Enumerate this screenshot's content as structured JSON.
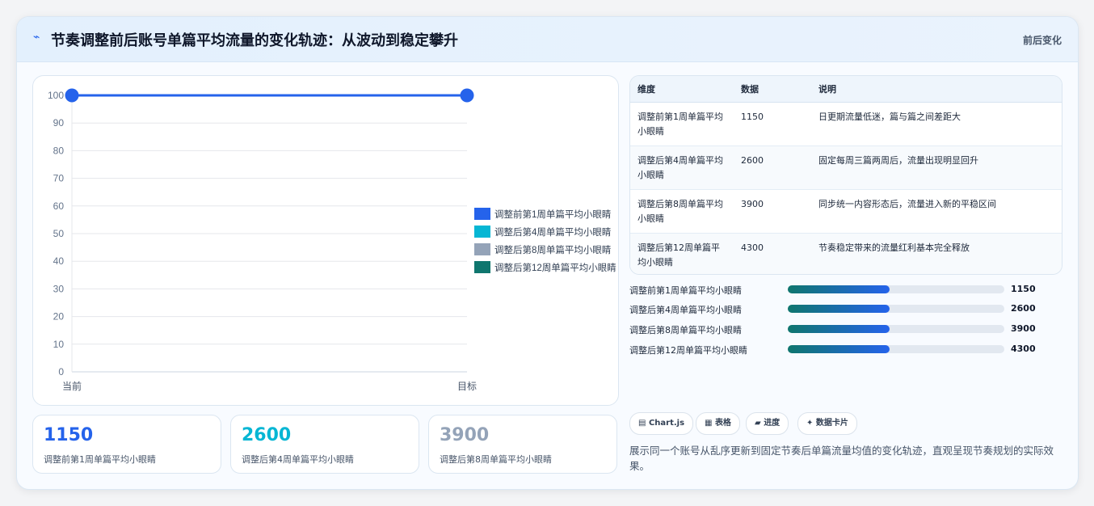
{
  "header": {
    "title_icon": "⌁",
    "title": "节奏调整前后账号单篇平均流量的变化轨迹：从波动到稳定攀升",
    "badge": "前后变化"
  },
  "chart_data": {
    "type": "line",
    "categories": [
      "当前",
      "目标"
    ],
    "y_ticks": [
      0,
      10,
      20,
      30,
      40,
      50,
      60,
      70,
      80,
      90,
      100
    ],
    "ylim": [
      0,
      100
    ],
    "series": [
      {
        "values": [
          100,
          100
        ],
        "color": "#2563eb"
      }
    ],
    "legend": [
      {
        "name": "调整前第1周单篇平均小眼睛",
        "color": "#2563eb"
      },
      {
        "name": "调整后第4周单篇平均小眼睛",
        "color": "#06b6d4"
      },
      {
        "name": "调整后第8周单篇平均小眼睛",
        "color": "#94a3b8"
      },
      {
        "name": "调整后第12周单篇平均小眼睛",
        "color": "#0f766e"
      }
    ],
    "legend_position": "right",
    "grid": true
  },
  "stats": [
    {
      "value": "1150",
      "label": "调整前第1周单篇平均小眼睛",
      "color": "#2563eb"
    },
    {
      "value": "2600",
      "label": "调整后第4周单篇平均小眼睛",
      "color": "#06b6d4"
    },
    {
      "value": "3900",
      "label": "调整后第8周单篇平均小眼睛",
      "color": "#94a3b8"
    }
  ],
  "table": {
    "headers": [
      "维度",
      "数据",
      "说明"
    ],
    "rows": [
      {
        "dim": "调整前第1周单篇平均小眼睛",
        "value": "1150",
        "note": "日更期流量低迷，篇与篇之间差距大"
      },
      {
        "dim": "调整后第4周单篇平均小眼睛",
        "value": "2600",
        "note": "固定每周三篇两周后，流量出现明显回升"
      },
      {
        "dim": "调整后第8周单篇平均小眼睛",
        "value": "3900",
        "note": "同步统一内容形态后，流量进入新的平稳区间"
      },
      {
        "dim": "调整后第12周单篇平均小眼睛",
        "value": "4300",
        "note": "节奏稳定带来的流量红利基本完全释放"
      }
    ]
  },
  "progress": [
    {
      "label": "调整前第1周单篇平均小眼睛",
      "value": "1150",
      "fraction": 0.47
    },
    {
      "label": "调整后第4周单篇平均小眼睛",
      "value": "2600",
      "fraction": 0.47
    },
    {
      "label": "调整后第8周单篇平均小眼睛",
      "value": "3900",
      "fraction": 0.47
    },
    {
      "label": "调整后第12周单篇平均小眼睛",
      "value": "4300",
      "fraction": 0.47
    }
  ],
  "tags": [
    {
      "icon": "▤",
      "label": "Chart.js"
    },
    {
      "icon": "▦",
      "label": "表格"
    },
    {
      "icon": "▰",
      "label": "进度"
    },
    {
      "icon": "✦",
      "label": "数据卡片"
    }
  ],
  "description": "展示同一个账号从乱序更新到固定节奏后单篇流量均值的变化轨迹，直观呈现节奏规划的实际效果。"
}
